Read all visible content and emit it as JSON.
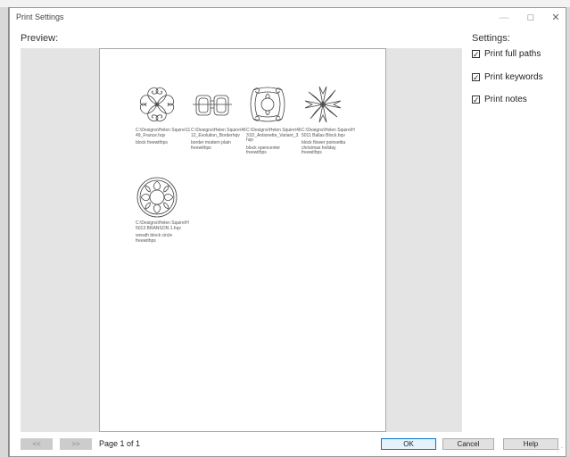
{
  "window": {
    "title": "Print Settings",
    "minimize": "—",
    "maximize": "□",
    "close": "✕"
  },
  "preview_label": "Preview:",
  "settings": {
    "label": "Settings:",
    "options": [
      {
        "label": "Print full paths",
        "checked": true
      },
      {
        "label": "Print keywords",
        "checked": true
      },
      {
        "label": "Print notes",
        "checked": true
      }
    ]
  },
  "designs": [
    {
      "path": "C:\\Designs\\Helen Squire\\1149_France.hqv",
      "keywords": "block freewithps",
      "icon": "scroll-block-icon"
    },
    {
      "path": "C:\\Designs\\Helen Squire\\4612_Evolution_Borderhqv",
      "keywords": "border modern plain freewithps",
      "icon": "interlock-border-icon"
    },
    {
      "path": "C:\\Designs\\Helen Squire\\4631D_Antionette_Variant_3.hqv",
      "keywords": "block opencenter freewithps",
      "icon": "open-center-block-icon"
    },
    {
      "path": "C:\\Designs\\Helen Squire\\H5011 Ballas Block.hqv",
      "keywords": "block flower poinsettia christmas holiday freewithps",
      "icon": "poinsettia-icon"
    },
    {
      "path": "C:\\Designs\\Helen Squire\\H5013 BRANSON 1.hqv",
      "keywords": "wreath block circle freewithps",
      "icon": "wreath-icon"
    }
  ],
  "footer": {
    "prev_label": "<<",
    "next_label": ">>",
    "page_status": "Page 1 of 1",
    "ok_label": "OK",
    "cancel_label": "Cancel",
    "help_label": "Help"
  }
}
